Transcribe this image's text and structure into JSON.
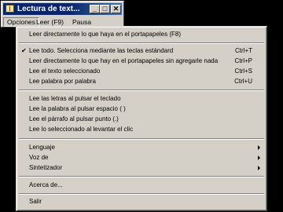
{
  "window": {
    "title": "Lectura de text..."
  },
  "menubar": {
    "items": [
      "Opciones",
      "Leer (F9)",
      "Pausa"
    ]
  },
  "menu": {
    "items": [
      {
        "label": "Leer directamente lo que haya en el portapapeles (F8)",
        "shortcut": ""
      },
      {
        "label": "Lee todo. Selecciona mediante las teclas estándard",
        "shortcut": "Ctrl+T",
        "checked": true
      },
      {
        "label": "Leer directamente lo que hay en el portapapeles sin agregarle nada",
        "shortcut": "Ctrl+P"
      },
      {
        "label": "Lee el texto seleccionado",
        "shortcut": "Ctrl+S"
      },
      {
        "label": "Lee palabra por palabra",
        "shortcut": "Ctrl+U"
      },
      {
        "label": "Lee las letras al pulsar el teclado",
        "shortcut": ""
      },
      {
        "label": "Lee la palabra al pulsar espacio ( )",
        "shortcut": ""
      },
      {
        "label": "Lee el párrafo al pulsar punto (.)",
        "shortcut": ""
      },
      {
        "label": "Lee lo seleccionado al levantar el clic",
        "shortcut": ""
      },
      {
        "label": "Lenguaje",
        "submenu": true
      },
      {
        "label": "Voz de",
        "submenu": true
      },
      {
        "label": "Sintetizador",
        "submenu": true
      },
      {
        "label": "Acerca de...",
        "shortcut": ""
      },
      {
        "label": "Salir",
        "shortcut": ""
      }
    ],
    "check_mark": "✔"
  }
}
